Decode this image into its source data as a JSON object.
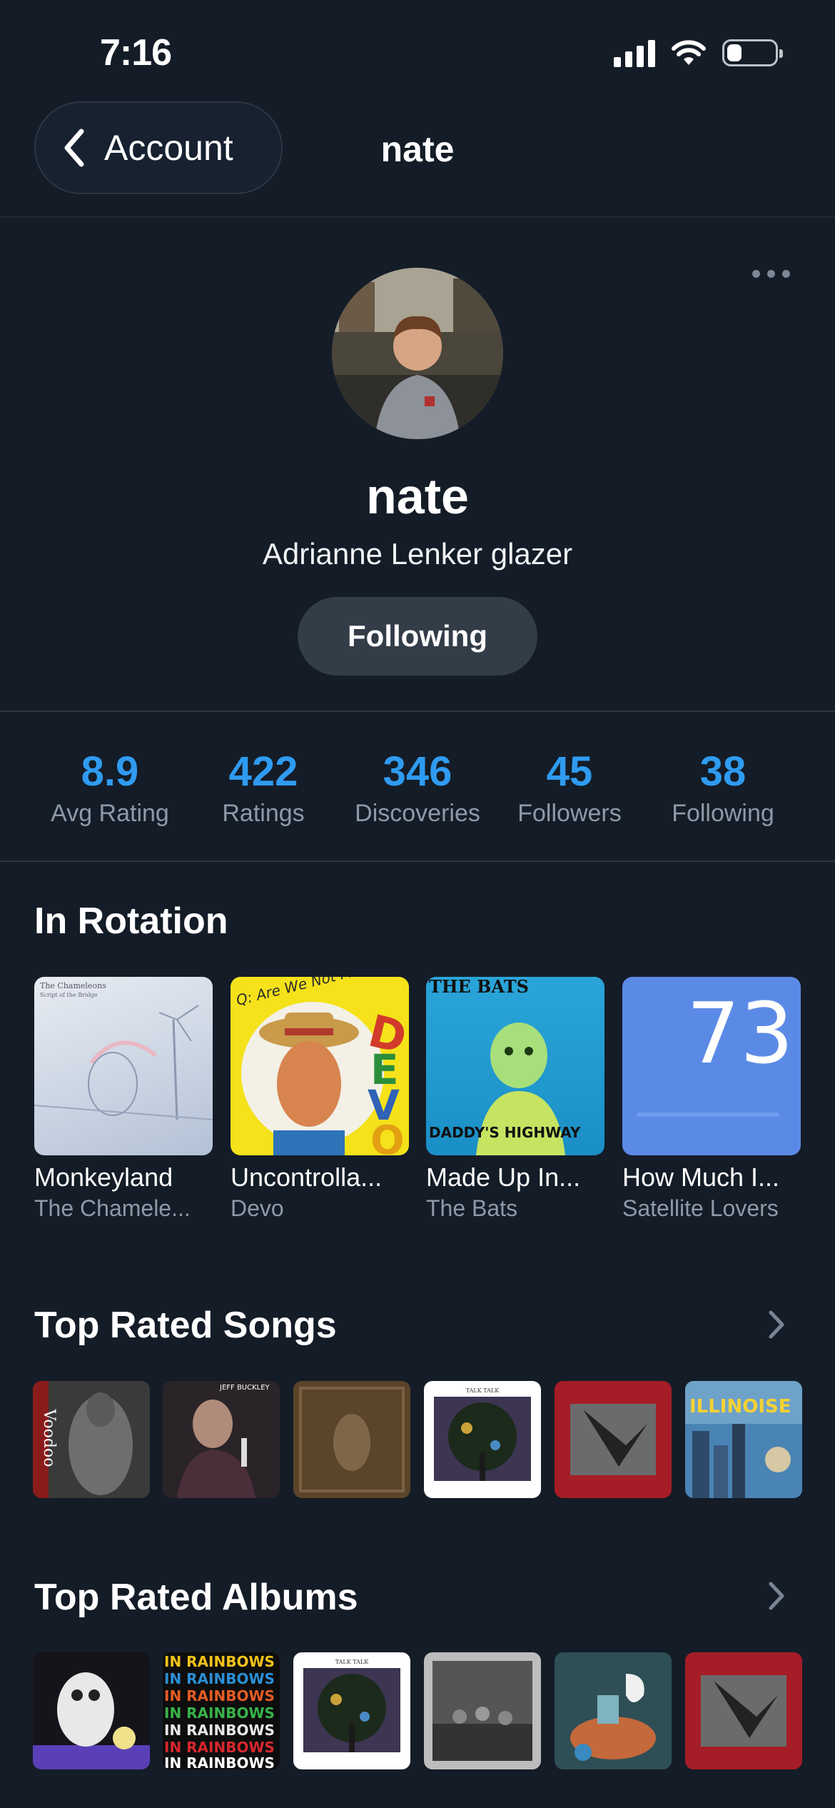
{
  "status_bar": {
    "time": "7:16",
    "battery_level": 0.3
  },
  "nav": {
    "back_label": "Account",
    "title": "nate"
  },
  "profile": {
    "name": "nate",
    "bio": "Adrianne Lenker glazer",
    "follow_button_label": "Following"
  },
  "stats": [
    {
      "value": "8.9",
      "label": "Avg Rating"
    },
    {
      "value": "422",
      "label": "Ratings"
    },
    {
      "value": "346",
      "label": "Discoveries"
    },
    {
      "value": "45",
      "label": "Followers"
    },
    {
      "value": "38",
      "label": "Following"
    }
  ],
  "in_rotation": {
    "title": "In Rotation",
    "items": [
      {
        "title": "Monkeyland",
        "artist": "The Chamele...",
        "cover_text": "The Chameleons",
        "cover_subtext": "Script of the Bridge"
      },
      {
        "title": "Uncontrolla...",
        "artist": "Devo",
        "cover_text": "DEVO",
        "cover_subtext": "Q: Are We Not Men?"
      },
      {
        "title": "Made Up In...",
        "artist": "The Bats",
        "cover_text": "THE BATS",
        "cover_subtext": "DADDY'S HIGHWAY"
      },
      {
        "title": "How Much I...",
        "artist": "Satellite Lovers",
        "cover_text": "73",
        "cover_subtext": ""
      }
    ]
  },
  "top_songs": {
    "title": "Top Rated Songs",
    "covers": [
      {
        "label": "Voodoo"
      },
      {
        "label": "JEFF BUCKLEY"
      },
      {
        "label": ""
      },
      {
        "label": "TALK TALK"
      },
      {
        "label": ""
      },
      {
        "label": "ILLINOISE"
      }
    ]
  },
  "top_albums": {
    "title": "Top Rated Albums",
    "covers": [
      {
        "label": ""
      },
      {
        "label": "IN RAINBOWS"
      },
      {
        "label": "TALK TALK"
      },
      {
        "label": ""
      },
      {
        "label": ""
      },
      {
        "label": ""
      }
    ]
  },
  "colors": {
    "background": "#141c27",
    "accent": "#2f9bf0",
    "muted": "#8f9aa8",
    "button": "#333d48"
  }
}
